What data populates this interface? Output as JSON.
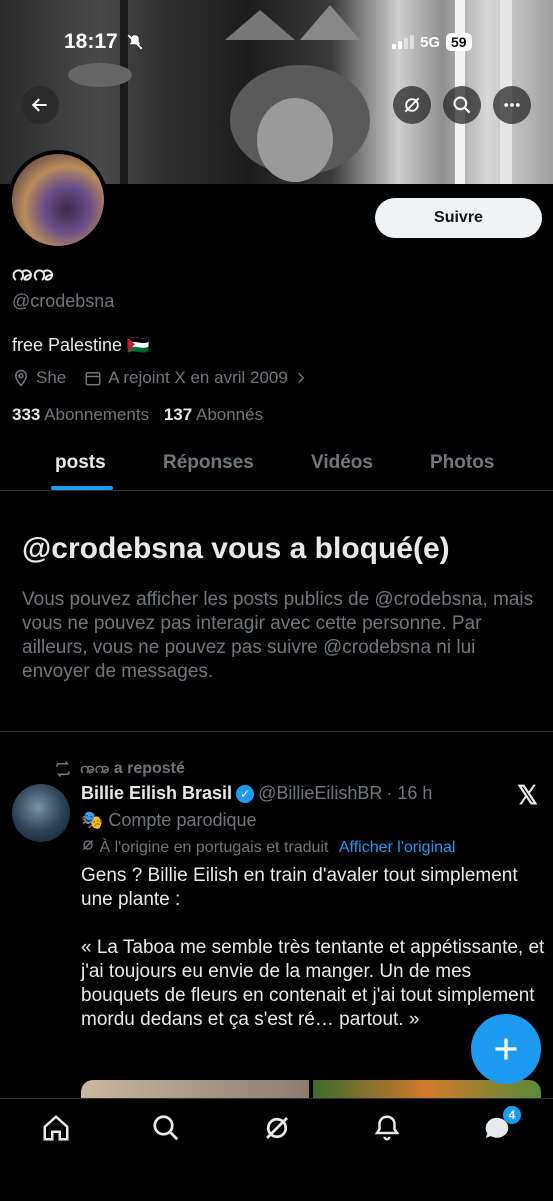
{
  "status_bar": {
    "time": "18:17",
    "network": "5G",
    "battery": "59"
  },
  "profile": {
    "follow_label": "Suivre",
    "name": "ꩠꩠ",
    "handle": "@crodebsna",
    "bio": "free Palestine 🇵🇸",
    "location": "She",
    "joined": "A rejoint X en avril 2009",
    "following_count": "333",
    "following_label": "Abonnements",
    "followers_count": "137",
    "followers_label": "Abonnés"
  },
  "tabs": [
    {
      "label": "posts",
      "active": true
    },
    {
      "label": "Réponses",
      "active": false
    },
    {
      "label": "Vidéos",
      "active": false
    },
    {
      "label": "Photos",
      "active": false
    }
  ],
  "blocked": {
    "title": "@crodebsna vous a bloqué(e)",
    "body": "Vous pouvez afficher les posts publics de @crodebsna, mais vous ne pouvez pas interagir avec cette personne. Par ailleurs, vous ne pouvez pas suivre @crodebsna ni lui envoyer de messages."
  },
  "post": {
    "repost_label": "ꩠꩠ a reposté",
    "author_name": "Billie Eilish Brasil",
    "author_handle": "@BillieEilishBR",
    "time": "· 16 h",
    "parody_label": "🎭 Compte parodique",
    "translated_note": "À l'origine en portugais et traduit",
    "show_original": "Afficher l'original",
    "text": "Gens ? Billie Eilish en train d'avaler tout simplement une plante :\n\n« La Taboa me semble très tentante et appétissante, et j'ai toujours eu envie de la manger. Un de mes bouquets de fleurs en contenait et j'ai tout simplement mordu dedans et ça s'est ré… partout. »"
  },
  "nav": {
    "messages_badge": "4"
  },
  "colors": {
    "accent": "#1d9bf0",
    "muted": "#71767b",
    "text": "#e7e9ea",
    "background": "#000000"
  }
}
